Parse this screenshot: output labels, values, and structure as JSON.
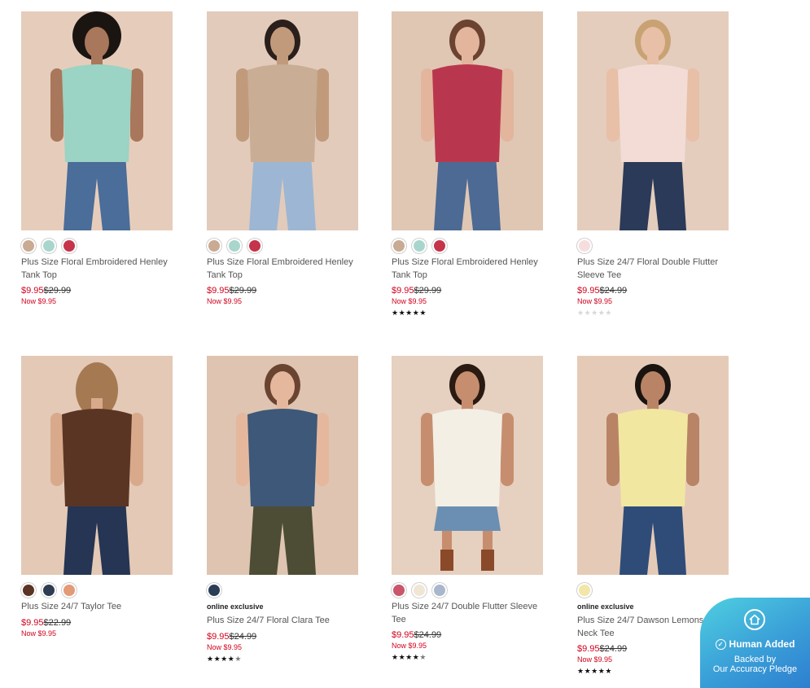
{
  "products": [
    {
      "name": "Plus Size Floral Embroidered Henley Tank Top",
      "badge": "",
      "sale_price": "$9.95",
      "original_price": "$29.99",
      "now_price": "Now $9.95",
      "swatches": [
        "#c9aa92",
        "#a9d6cc",
        "#c5344a"
      ],
      "rating": null,
      "image": {
        "bg": "#e6cdbb",
        "top": "#9bd3c4",
        "bottom": "#4a6d99",
        "skin": "#a9775b",
        "hair": "#1b1512",
        "curly": true
      }
    },
    {
      "name": "Plus Size Floral Embroidered Henley Tank Top",
      "badge": "",
      "sale_price": "$9.95",
      "original_price": "$29.99",
      "now_price": "Now $9.95",
      "swatches": [
        "#c9aa92",
        "#a9d6cc",
        "#c5344a"
      ],
      "rating": null,
      "image": {
        "bg": "#e2cbbb",
        "top": "#c9ad95",
        "bottom": "#9db6d3",
        "skin": "#c19a7c",
        "hair": "#2a1f1a",
        "curly": false
      }
    },
    {
      "name": "Plus Size Floral Embroidered Henley Tank Top",
      "badge": "",
      "sale_price": "$9.95",
      "original_price": "$29.99",
      "now_price": "Now $9.95",
      "swatches": [
        "#c9aa92",
        "#a9d6cc",
        "#c5344a"
      ],
      "rating": 5,
      "image": {
        "bg": "#e0c7b4",
        "top": "#b9374e",
        "bottom": "#4c6a93",
        "skin": "#e2b59c",
        "hair": "#6b4330",
        "curly": false
      }
    },
    {
      "name": "Plus Size 24/7 Floral Double Flutter Sleeve Tee",
      "badge": "",
      "sale_price": "$9.95",
      "original_price": "$24.99",
      "now_price": "Now $9.95",
      "swatches": [
        "#f6dede"
      ],
      "rating": 0,
      "image": {
        "bg": "#e4cdbd",
        "top": "#f3dcd6",
        "bottom": "#2a3a58",
        "skin": "#e8bfa7",
        "hair": "#c9a273",
        "curly": false
      }
    },
    {
      "name": "Plus Size 24/7 Taylor Tee",
      "badge": "",
      "sale_price": "$9.95",
      "original_price": "$22.99",
      "now_price": "Now $9.95",
      "swatches": [
        "#5a3424",
        "#2e3d52",
        "#e39a76"
      ],
      "rating": null,
      "image": {
        "bg": "#e3c9b6",
        "top": "#5b3524",
        "bottom": "#253553",
        "skin": "#d9a98c",
        "hair": "#a57a52",
        "curly": false
      }
    },
    {
      "name": "Plus Size 24/7 Floral Clara Tee",
      "badge": "online exclusive",
      "sale_price": "$9.95",
      "original_price": "$24.99",
      "now_price": "Now $9.95",
      "swatches": [
        "#2b3d57"
      ],
      "rating": 4.5,
      "image": {
        "bg": "#dec4b1",
        "top": "#3d5878",
        "bottom": "#4c4d34",
        "skin": "#e5b89d",
        "hair": "#6a4430",
        "curly": false
      }
    },
    {
      "name": "Plus Size 24/7 Double Flutter Sleeve Tee",
      "badge": "",
      "sale_price": "$9.95",
      "original_price": "$24.99",
      "now_price": "Now $9.95",
      "swatches": [
        "#c9566a",
        "#efe6d4",
        "#a9b7cc"
      ],
      "rating": 4.5,
      "image": {
        "bg": "#e6d0c0",
        "top": "#f4efe5",
        "bottom": "#6b8fb3",
        "skin": "#c68e6e",
        "hair": "#2a1a12",
        "curly": false
      }
    },
    {
      "name": "Plus Size 24/7 Dawson Lemons Crew Neck Tee",
      "badge": "online exclusive",
      "sale_price": "$9.95",
      "original_price": "$24.99",
      "now_price": "Now $9.95",
      "swatches": [
        "#f2e6a8"
      ],
      "rating": 5,
      "image": {
        "bg": "#e5cbb7",
        "top": "#f2e7a1",
        "bottom": "#2f4c78",
        "skin": "#b98466",
        "hair": "#1a1411",
        "curly": false
      }
    }
  ],
  "pledge": {
    "title": "Human Added",
    "line1": "Backed by",
    "line2": "Our Accuracy Pledge",
    "icon": "home-icon",
    "check_icon": "check-circle-icon"
  }
}
